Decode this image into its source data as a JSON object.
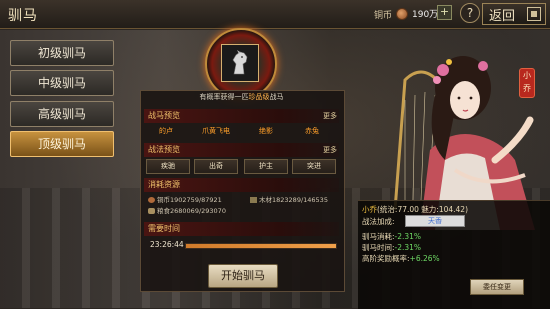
{
  "header": {
    "title": "驯马",
    "coin_label": "铜币",
    "coin_value": "190万",
    "plus_label": "+",
    "help_label": "?",
    "back_label": "返回"
  },
  "tabs": [
    {
      "label": "初级驯马",
      "active": false
    },
    {
      "label": "中级驯马",
      "active": false
    },
    {
      "label": "高级驯马",
      "active": false
    },
    {
      "label": "顶级驯马",
      "active": true
    }
  ],
  "notice": {
    "prefix": "有概率获得一匹",
    "highlight": "珍品级",
    "suffix": "战马"
  },
  "horse_preview": {
    "title": "战马预览",
    "more": "更多",
    "items": [
      "的卢",
      "爪黄飞电",
      "绝影",
      "赤兔"
    ]
  },
  "skill_preview": {
    "title": "战法预览",
    "more": "更多",
    "items": [
      "疾驰",
      "出奇",
      "护主",
      "突进"
    ]
  },
  "resources": {
    "title": "消耗资源",
    "copper": "铜币1902759/87921",
    "wood": "木材1823289/146535",
    "grain": "粮食2680069/293070"
  },
  "time": {
    "title": "需要时间",
    "value": "23:26:44",
    "progress_fraction": 1.0
  },
  "start_button": "开始驯马",
  "character": {
    "name_tag": "小乔",
    "stats_line_name": "小乔",
    "stats_line_rest": "(统治:77.00 魅力:104.42)",
    "skill_label": "战法加成:",
    "skill_name": "天香",
    "consume_label": "驯马消耗:",
    "consume_value": "-2.31%",
    "time_label": "驯马时间:",
    "time_value": "-2.31%",
    "reward_label": "高阶奖励概率:",
    "reward_value": "+6.26%",
    "swap_button": "委任变更"
  },
  "colors": {
    "accent_gold": "#f0c040",
    "highlight_orange": "#ffb24a",
    "green": "#6ed864",
    "tab_active": "#c7923f"
  }
}
